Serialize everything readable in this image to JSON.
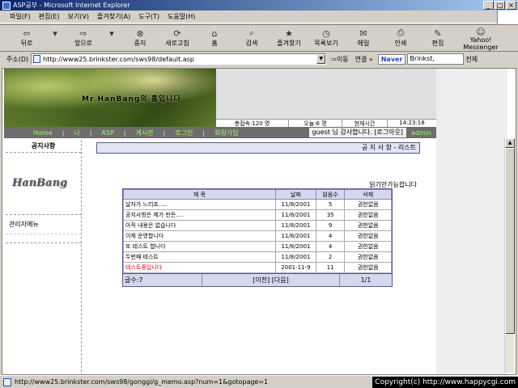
{
  "window": {
    "title": "ASP공부 - Microsoft Internet Explorer",
    "min": "_",
    "max": "□",
    "close": "×"
  },
  "menu": [
    "파일(F)",
    "편집(E)",
    "보기(V)",
    "즐겨찾기(A)",
    "도구(T)",
    "도움말(H)"
  ],
  "toolbar": [
    {
      "label": "뒤로",
      "icon": "back-arrow-icon",
      "glyph": "⇦"
    },
    {
      "label": "▾",
      "icon": "dropdown-icon",
      "glyph": ""
    },
    {
      "label": "앞으로",
      "icon": "forward-arrow-icon",
      "glyph": "⇨"
    },
    {
      "label": "▾",
      "icon": "dropdown-icon",
      "glyph": ""
    },
    {
      "label": "중지",
      "icon": "stop-icon",
      "glyph": "⊗"
    },
    {
      "label": "새로고침",
      "icon": "refresh-icon",
      "glyph": "⟳"
    },
    {
      "label": "홈",
      "icon": "home-icon",
      "glyph": "⌂"
    },
    {
      "label": "검색",
      "icon": "search-icon",
      "glyph": "⌕"
    },
    {
      "label": "즐겨찾기",
      "icon": "favorites-icon",
      "glyph": "★"
    },
    {
      "label": "목록보기",
      "icon": "history-icon",
      "glyph": "◷"
    },
    {
      "label": "메일",
      "icon": "mail-icon",
      "glyph": "✉"
    },
    {
      "label": "인쇄",
      "icon": "print-icon",
      "glyph": "⎙"
    },
    {
      "label": "편집",
      "icon": "edit-icon",
      "glyph": "✎"
    },
    {
      "label": "Yahoo! Messenger",
      "icon": "messenger-icon",
      "glyph": "☺"
    }
  ],
  "address": {
    "label": "주소(D)",
    "url": "http://www25.brinkster.com/sws98/default.asp",
    "go": "이동",
    "links": "연결 »",
    "naver_label": "Naver",
    "search_value": "Brinkst,",
    "all": "전체"
  },
  "header": {
    "banner_title": "Mr HanBang의 홈입니다"
  },
  "stats": {
    "total": "총접속:120 명",
    "today": "오늘:6 명",
    "time_label": "현재시간",
    "time": "14:23:18"
  },
  "nav": {
    "items": [
      "Home",
      "나",
      "ASP",
      "게시판",
      "로그인",
      "회원가입"
    ],
    "greeting": "guest 님 감사합니다. [로그아웃]",
    "admin": "admin"
  },
  "left": {
    "heading": "공지사항",
    "logo": "HanBang",
    "admin_menu": "관리자메뉴"
  },
  "notice": {
    "bar": "공 지 사 항 - 리스트",
    "readonly": "읽기만가능합니다"
  },
  "board": {
    "columns": [
      "제     목",
      "날짜",
      "읽음수",
      "삭제"
    ],
    "rows": [
      {
        "subject": "날자가 느리죠.....",
        "date": "11/8/2001",
        "reads": "5",
        "delete": "권한없음",
        "red": false
      },
      {
        "subject": "공지사항은 제가 만든....",
        "date": "11/8/2001",
        "reads": "35",
        "delete": "권한없음",
        "red": false
      },
      {
        "subject": "아직 내용은 없습니다",
        "date": "11/8/2001",
        "reads": "9",
        "delete": "권한없음",
        "red": false
      },
      {
        "subject": "이제 운영합니다",
        "date": "11/8/2001",
        "reads": "4",
        "delete": "권한없음",
        "red": false
      },
      {
        "subject": "또 테스트 합니다",
        "date": "11/8/2001",
        "reads": "4",
        "delete": "권한없음",
        "red": false
      },
      {
        "subject": "두번째 테스트",
        "date": "11/8/2001",
        "reads": "2",
        "delete": "권한없음",
        "red": false
      },
      {
        "subject": "테스트중입니다",
        "date": "2001-11-9",
        "reads": "11",
        "delete": "권한없음",
        "red": true
      }
    ],
    "count": "글수:7",
    "pager": "[이전] [다음]",
    "page": "1/1"
  },
  "status": {
    "url": "http://www25.brinkster.com/sws98/gonggi/g_memo.asp?num=1&gotopage=1"
  },
  "copyright": "Copyright(c) http://www.happycgi.com"
}
